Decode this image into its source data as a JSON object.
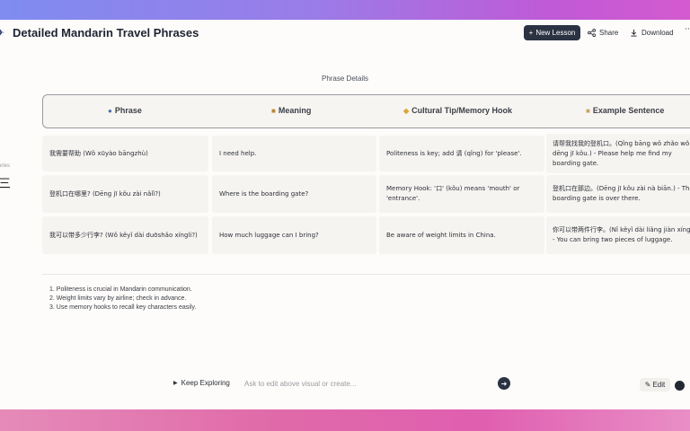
{
  "header": {
    "title": "Detailed Mandarin Travel Phrases",
    "new_lesson": "New Lesson",
    "share": "Share",
    "download": "Download",
    "more": "···"
  },
  "sidebar": {
    "fragment": "ories",
    "glyph": "三"
  },
  "section": {
    "title": "Phrase Details"
  },
  "table": {
    "columns": [
      {
        "label": "Phrase",
        "icon": "speech-bubble-icon"
      },
      {
        "label": "Meaning",
        "icon": "book-icon"
      },
      {
        "label": "Cultural Tip/Memory Hook",
        "icon": "key-icon"
      },
      {
        "label": "Example Sentence",
        "icon": "notepad-icon"
      }
    ],
    "rows": [
      {
        "phrase": "我需要帮助 (Wǒ xūyào bāngzhù)",
        "meaning": "I need help.",
        "tip": "Politeness is key; add 请 (qǐng) for 'please'.",
        "example": "请帮我找我的登机口。(Qǐng bāng wǒ zhǎo wǒ de dēng jī kǒu.) - Please help me find my boarding gate."
      },
      {
        "phrase": "登机口在哪里? (Dēng jī kǒu zài nǎlǐ?)",
        "meaning": "Where is the boarding gate?",
        "tip": "Memory Hook: '口' (kǒu) means 'mouth' or 'entrance'.",
        "example": "登机口在那边。(Dēng jī kǒu zài nà biān.) - The boarding gate is over there."
      },
      {
        "phrase": "我可以带多少行李? (Wǒ kěyǐ dài duōshǎo xíngli?)",
        "meaning": "How much luggage can I bring?",
        "tip": "Be aware of weight limits in China.",
        "example": "你可以带两件行李。(Nǐ kěyǐ dài liǎng jiàn xíngli.) - You can bring two pieces of luggage."
      }
    ]
  },
  "notes": [
    "1. Politeness is crucial in Mandarin communication.",
    "2. Weight limits vary by airline; check in advance.",
    "3. Use memory hooks to recall key characters easily."
  ],
  "footer": {
    "keep_exploring": "Keep Exploring",
    "ask_placeholder": "Ask to edit above visual or create...",
    "edit": "Edit"
  }
}
